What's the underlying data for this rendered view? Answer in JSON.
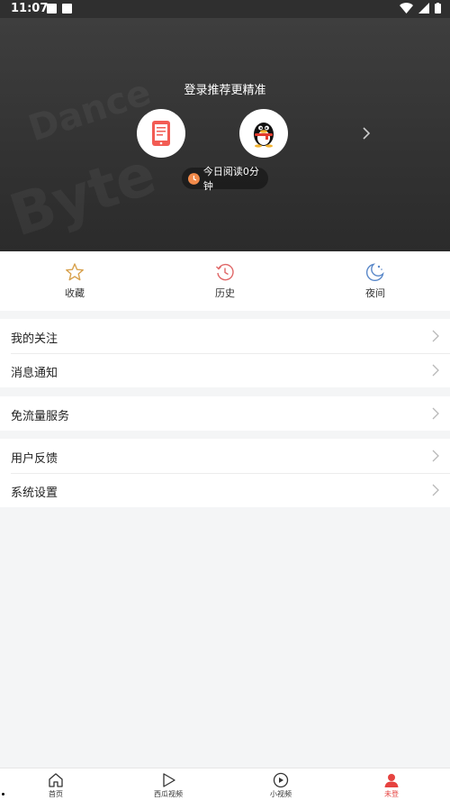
{
  "status_bar": {
    "time": "11:07"
  },
  "header": {
    "login_title": "登录推荐更精准",
    "read_time": "今日阅读0分钟",
    "background_words": [
      "Byte",
      "Dance"
    ]
  },
  "quick_actions": [
    {
      "label": "收藏",
      "icon": "star-icon",
      "color": "#d8a24e"
    },
    {
      "label": "历史",
      "icon": "history-icon",
      "color": "#e06767"
    },
    {
      "label": "夜间",
      "icon": "moon-icon",
      "color": "#5a88c9"
    }
  ],
  "menu": {
    "group1": [
      "我的关注",
      "消息通知"
    ],
    "group2": [
      "免流量服务"
    ],
    "group3": [
      "用户反馈",
      "系统设置"
    ]
  },
  "bottom_nav": [
    {
      "label": "首页",
      "icon": "home-icon"
    },
    {
      "label": "西瓜视频",
      "icon": "play-icon"
    },
    {
      "label": "小视频",
      "icon": "small-video-icon"
    },
    {
      "label": "未登",
      "icon": "user-icon",
      "active": true
    }
  ],
  "colors": {
    "accent": "#e64340",
    "header_bg": "#333333",
    "page_bg": "#f4f5f6"
  }
}
